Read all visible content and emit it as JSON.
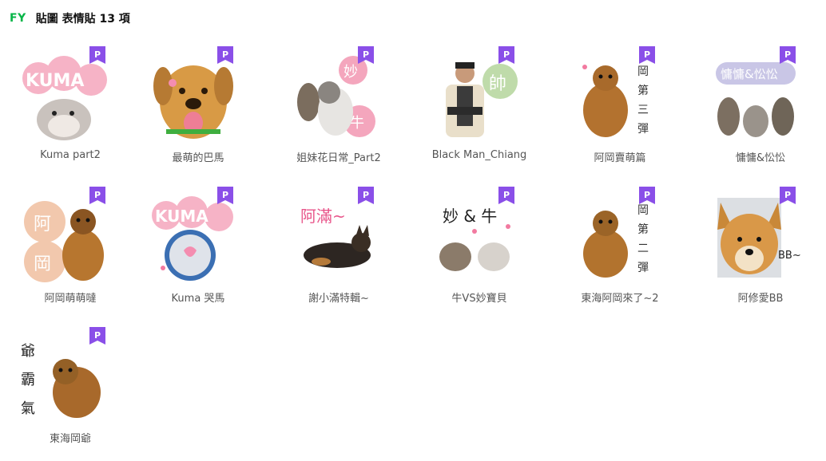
{
  "header": {
    "brand": "FY",
    "title": "貼圖 表情貼 13 項"
  },
  "colors": {
    "brand": "#06b547",
    "premium_badge": "#8a4fe8"
  },
  "badge_letter": "P",
  "items": [
    {
      "name": "Kuma part2",
      "art": "hamster-kuma"
    },
    {
      "name": "最萌的巴馬",
      "art": "dog-tongue"
    },
    {
      "name": "姐妹花日常_Part2",
      "art": "cats-miao-niu"
    },
    {
      "name": "Black Man_Chiang",
      "art": "man-shuai"
    },
    {
      "name": "阿岡賣萌篇",
      "art": "dog-third"
    },
    {
      "name": "慵慵&忪忪",
      "art": "cats-group"
    },
    {
      "name": "阿岡萌萌噠",
      "art": "dog-agang"
    },
    {
      "name": "Kuma 哭馬",
      "art": "hamster-kuma-blue"
    },
    {
      "name": "謝小滿特輯~",
      "art": "dog-aman"
    },
    {
      "name": "牛VS妙寶貝",
      "art": "cats-vs"
    },
    {
      "name": "東海阿岡來了~2",
      "art": "dog-second"
    },
    {
      "name": "阿修愛BB",
      "art": "dog-bb"
    },
    {
      "name": "東海岡爺",
      "art": "dog-grandpa"
    }
  ]
}
